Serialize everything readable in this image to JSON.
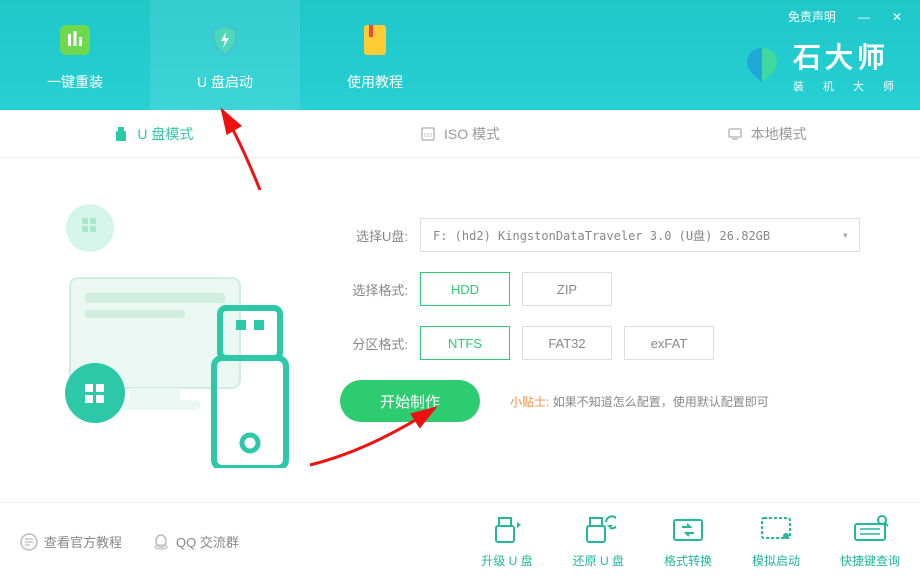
{
  "titlebar": {
    "disclaimer": "免责声明",
    "minimize": "—",
    "close": "✕"
  },
  "brand": {
    "title": "石大师",
    "subtitle": "装 机 大 师"
  },
  "nav": [
    {
      "label": "一键重装"
    },
    {
      "label": "U 盘启动"
    },
    {
      "label": "使用教程"
    }
  ],
  "subtabs": [
    {
      "label": "U 盘模式"
    },
    {
      "label": "ISO 模式"
    },
    {
      "label": "本地模式"
    }
  ],
  "form": {
    "disk_label": "选择U盘:",
    "disk_value": "F: (hd2) KingstonDataTraveler 3.0 (U盘) 26.82GB",
    "format_label": "选择格式:",
    "format_options": [
      "HDD",
      "ZIP"
    ],
    "format_selected": 0,
    "partition_label": "分区格式:",
    "partition_options": [
      "NTFS",
      "FAT32",
      "exFAT"
    ],
    "partition_selected": 0,
    "start_button": "开始制作",
    "tip_label": "小贴士:",
    "tip_text": "如果不知道怎么配置，使用默认配置即可"
  },
  "bottom_links": [
    {
      "label": "查看官方教程"
    },
    {
      "label": "QQ 交流群"
    }
  ],
  "tools": [
    {
      "label": "升级 U 盘"
    },
    {
      "label": "还原 U 盘"
    },
    {
      "label": "格式转换"
    },
    {
      "label": "模拟启动"
    },
    {
      "label": "快捷键查询"
    }
  ]
}
